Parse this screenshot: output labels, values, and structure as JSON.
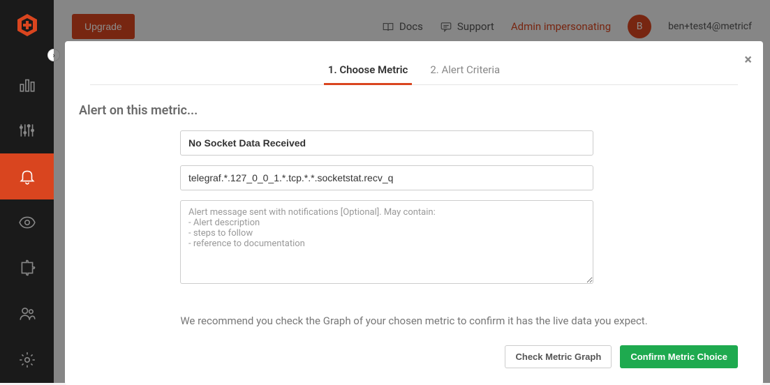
{
  "header": {
    "upgrade": "Upgrade",
    "docs": "Docs",
    "support": "Support",
    "admin": "Admin impersonating",
    "avatar_initial": "B",
    "email": "ben+test4@metricf"
  },
  "modal": {
    "tabs": {
      "choose": "1. Choose Metric",
      "criteria": "2. Alert Criteria"
    },
    "heading": "Alert on this metric...",
    "name_value": "No Socket Data Received",
    "metric_value": "telegraf.*.127_0_0_1.*.tcp.*.*.socketstat.recv_q",
    "message_placeholder": "Alert message sent with notifications [Optional]. May contain:\n- Alert description\n- steps to follow\n- reference to documentation",
    "recommendation": "We recommend you check the Graph of your chosen metric to confirm it has the live data you expect.",
    "check_btn": "Check Metric Graph",
    "confirm_btn": "Confirm Metric Choice"
  }
}
